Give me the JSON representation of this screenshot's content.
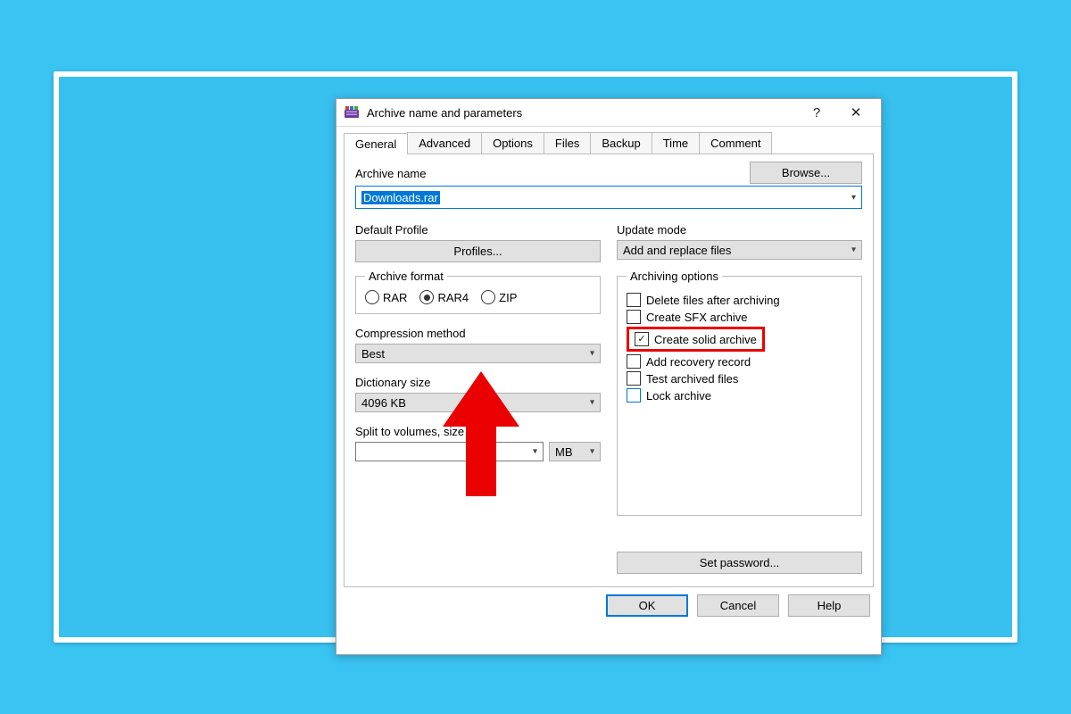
{
  "title": "Archive name and parameters",
  "win": {
    "help": "?",
    "close": "✕"
  },
  "tabs": [
    "General",
    "Advanced",
    "Options",
    "Files",
    "Backup",
    "Time",
    "Comment"
  ],
  "labels": {
    "archiveName": "Archive name",
    "defaultProfile": "Default Profile",
    "updateMode": "Update mode",
    "archiveFormat": "Archive format",
    "compressionMethod": "Compression method",
    "dictionarySize": "Dictionary size",
    "splitVolumes": "Split to volumes, size",
    "archivingOptions": "Archiving options"
  },
  "buttons": {
    "browse": "Browse...",
    "profiles": "Profiles...",
    "setPassword": "Set password...",
    "ok": "OK",
    "cancel": "Cancel",
    "help": "Help"
  },
  "values": {
    "archiveName": "Downloads.rar",
    "updateMode": "Add and replace files",
    "compressionMethod": "Best",
    "dictionarySize": "4096 KB",
    "splitSize": "",
    "splitUnit": "MB"
  },
  "formats": [
    "RAR",
    "RAR4",
    "ZIP"
  ],
  "selectedFormat": "RAR4",
  "options": [
    "Delete files after archiving",
    "Create SFX archive",
    "Create solid archive",
    "Add recovery record",
    "Test archived files",
    "Lock archive"
  ],
  "checkedOptions": [
    "Create solid archive"
  ],
  "annotation": {
    "arrowTarget": "compression-method-select",
    "highlightTarget": "opt-create-solid",
    "highlightColor": "#ea0000"
  }
}
